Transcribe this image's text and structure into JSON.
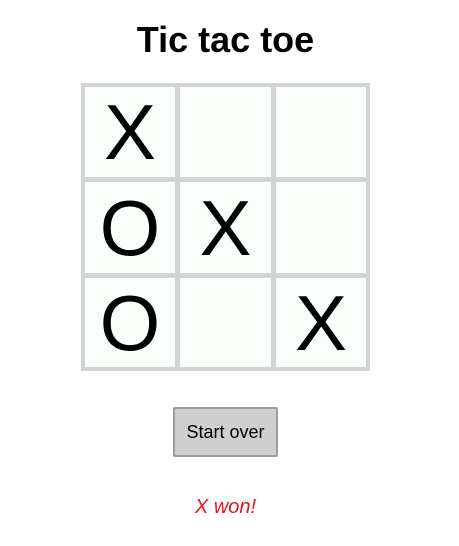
{
  "game": {
    "title": "Tic tac toe",
    "board": {
      "cells": [
        {
          "mark": "X"
        },
        {
          "mark": ""
        },
        {
          "mark": ""
        },
        {
          "mark": "O"
        },
        {
          "mark": "X"
        },
        {
          "mark": ""
        },
        {
          "mark": "O"
        },
        {
          "mark": ""
        },
        {
          "mark": "X"
        }
      ]
    },
    "start_over_label": "Start over",
    "status": "X won!",
    "colors": {
      "status_text": "#e8141c",
      "cell_background": "#fbfffb",
      "grid_lines": "#d3d3d3",
      "button_background": "#cfcfcf"
    }
  }
}
